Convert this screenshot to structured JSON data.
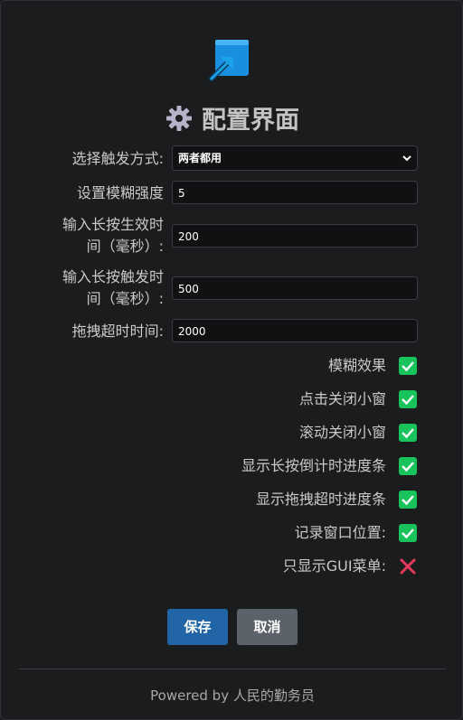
{
  "title": "配置界面",
  "form": {
    "trigger_label": "选择触发方式:",
    "trigger_value": "两者都用",
    "blur_label": "设置模糊强度",
    "blur_value": "5",
    "longpress_effect_label_1": "输入长按生效时",
    "longpress_effect_label_2": "间（毫秒）:",
    "longpress_effect_value": "200",
    "longpress_trigger_label_1": "输入长按触发时",
    "longpress_trigger_label_2": "间（毫秒）:",
    "longpress_trigger_value": "500",
    "drag_timeout_label": "拖拽超时时间:",
    "drag_timeout_value": "2000"
  },
  "checkboxes": [
    {
      "label": "模糊效果",
      "checked": true
    },
    {
      "label": "点击关闭小窗",
      "checked": true
    },
    {
      "label": "滚动关闭小窗",
      "checked": true
    },
    {
      "label": "显示长按倒计时进度条",
      "checked": true
    },
    {
      "label": "显示拖拽超时进度条",
      "checked": true
    },
    {
      "label": "记录窗口位置:",
      "checked": true
    },
    {
      "label": "只显示GUI菜单:",
      "checked": false
    }
  ],
  "buttons": {
    "save": "保存",
    "cancel": "取消"
  },
  "footer": "Powered by 人民的勤务员",
  "colors": {
    "checked": "#19c35c",
    "unchecked": "#e8395a",
    "save": "#2265a7",
    "cancel": "#5b6269"
  }
}
